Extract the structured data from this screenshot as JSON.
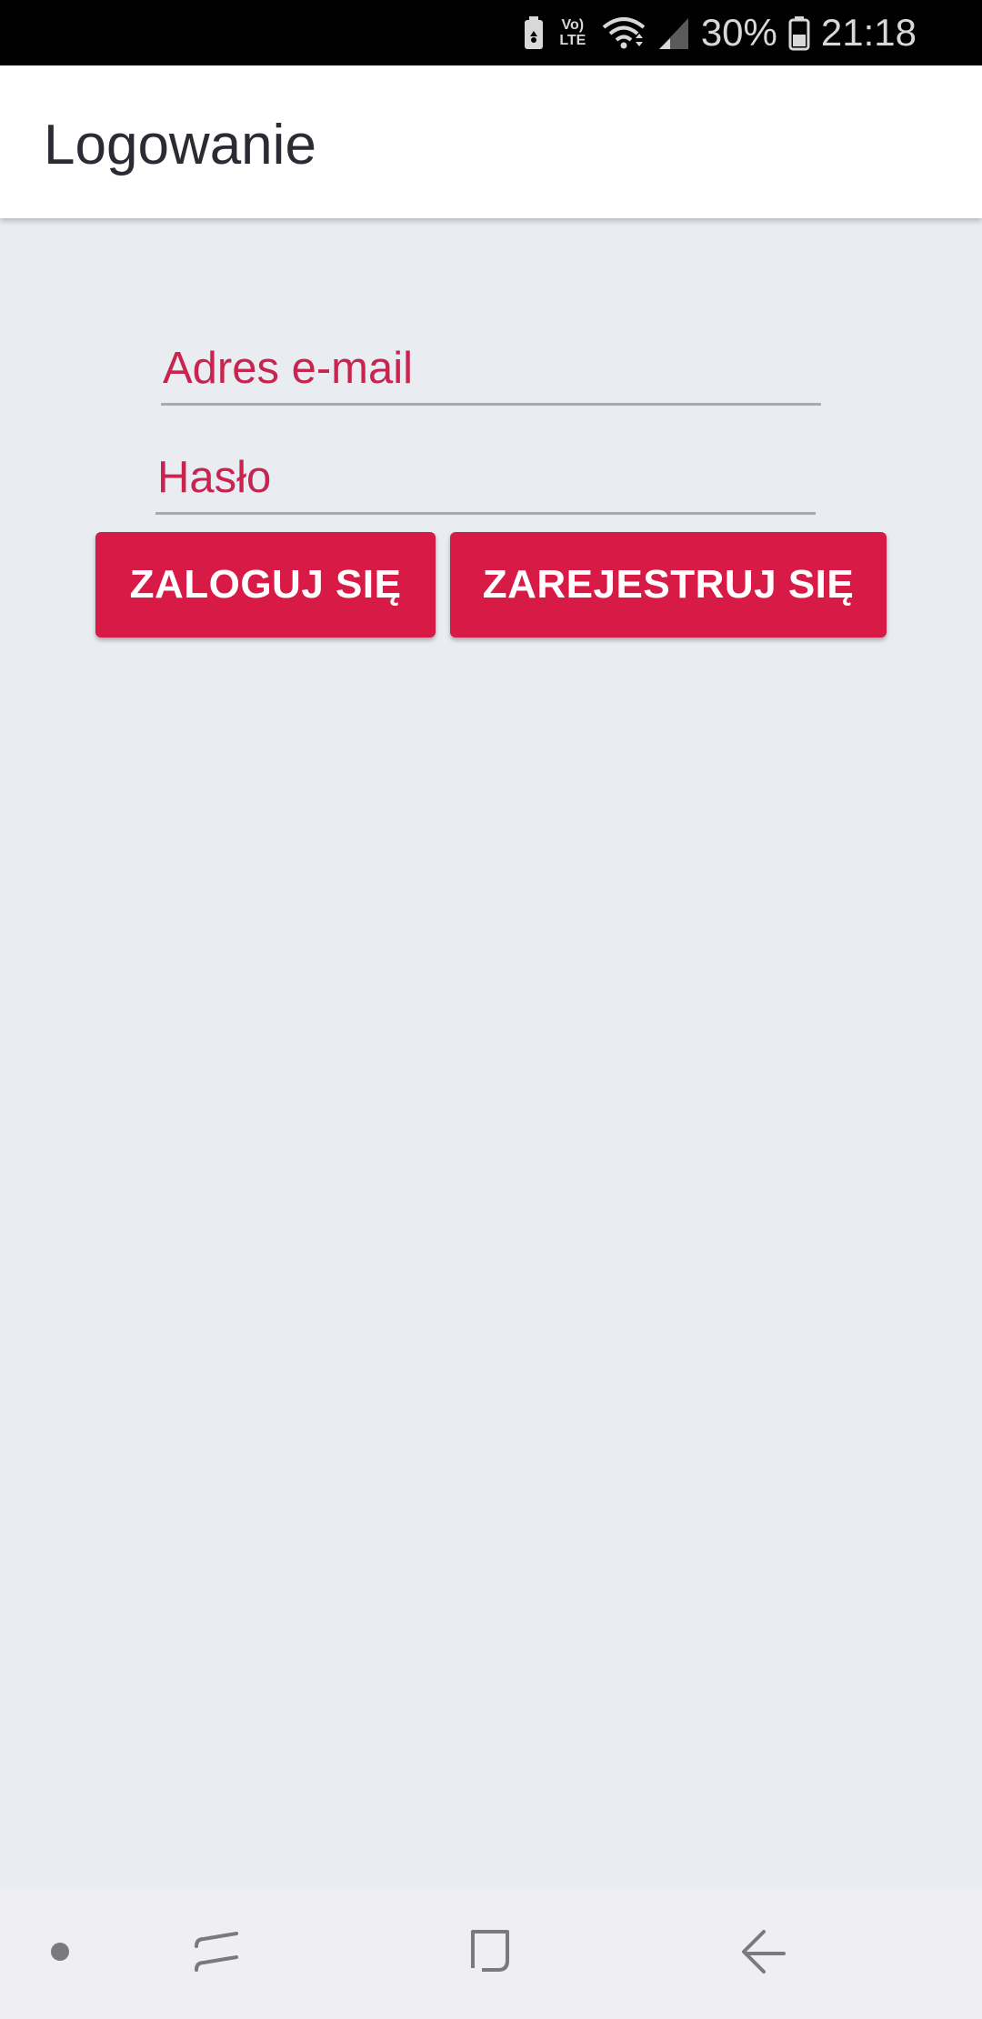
{
  "status_bar": {
    "volte_top": "Vo)",
    "volte_bottom": "LTE",
    "battery_percent": "30%",
    "time": "21:18",
    "icons": [
      "battery-saver-icon",
      "volte-icon",
      "wifi-icon",
      "cellular-signal-icon",
      "battery-icon"
    ]
  },
  "app_bar": {
    "title": "Logowanie"
  },
  "form": {
    "email_label": "Adres e-mail",
    "password_label": "Hasło"
  },
  "buttons": {
    "login_label": "ZALOGUJ SIĘ",
    "register_label": "ZAREJESTRUJ SIĘ"
  },
  "nav_bar": {
    "items": [
      "dot-icon",
      "recent-apps-icon",
      "home-icon",
      "back-icon"
    ]
  },
  "colors": {
    "accent": "#d81b46",
    "label": "#c8244f",
    "background": "#e9ecf0",
    "app_bar": "#ffffff",
    "status_bar": "#000000"
  }
}
